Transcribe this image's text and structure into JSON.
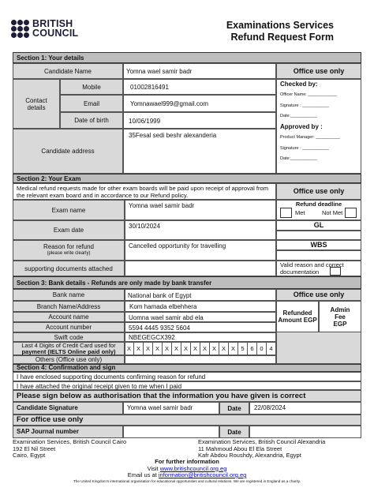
{
  "logo": {
    "line1": "BRITISH",
    "line2": "COUNCIL"
  },
  "header": {
    "line1": "Examinations Services",
    "line2": "Refund Request Form"
  },
  "section1": {
    "title": "Section 1: Your details",
    "candidate_name_label": "Candidate Name",
    "candidate_name_value": "Yomna wael samir badr",
    "contact_label_1": "Contact",
    "contact_label_2": "details",
    "mobile_label": "Mobile",
    "mobile_value": "01002816491",
    "email_label": "Email",
    "email_value": "Yomnawael999@gmail.com",
    "dob_label": "Date of birth",
    "dob_value": "10/06/1999",
    "address_label": "Candidate address",
    "address_value": "35Fesal sedi beshr alexanderia"
  },
  "office1": {
    "head": "Office use only",
    "checked_by": "Checked by:",
    "officer_name": "Officer Name: ____________",
    "signature": "Signature : ___________",
    "date": "Date:___________",
    "approved_by": "Approved by :",
    "product_manager": "Product Manager: __________",
    "signature2": "Signature : ___________",
    "date2": "Date:___________"
  },
  "section2": {
    "title": "Section 2: Your Exam",
    "notice": "Medical refund requests made for other exam boards will be paid upon receipt of approval from the relevant exam board and in accordance to our Refund policy.",
    "exam_name_label": "Exam name",
    "exam_name_value": "Yomna wael samir badr",
    "exam_date_label": "Exam date",
    "exam_date_value": "30/10/2024",
    "reason_label": "Reason for refund",
    "reason_sub": "(please write clearly)",
    "reason_value": "Cancelled opportunity for travelling",
    "docs_label": "supporting documents attached",
    "office_head": "Office use only",
    "refund_deadline": "Refund deadline",
    "met": "Met",
    "not_met": "Not Met",
    "gl": "GL",
    "wbs": "WBS",
    "valid_reason": "Valid reason and correct documentation"
  },
  "section3": {
    "title": "Section 3: Bank details - Refunds are only made by bank transfer",
    "bank_name_label": "Bank name",
    "bank_name_value": "National bank of Egypt",
    "branch_label": "Branch Name/Address",
    "branch_value": "Kom hamada elbehhera",
    "account_name_label": "Account name",
    "account_name_value": "Uomna wael samir abd ela",
    "account_number_label": "Account number",
    "account_number_value": "5594 4445 9352 5604",
    "swift_label": "Swift code",
    "swift_value": "NBEGEGCX392",
    "card_label_1": "Last 4 Digits of Credit Card used for",
    "card_label_2": "payment (IELTS Online paid only)",
    "card_digits": [
      "X",
      "X",
      "X",
      "X",
      "X",
      "X",
      "X",
      "X",
      "X",
      "X",
      "X",
      "X",
      "5",
      "6",
      "0",
      "4"
    ],
    "others_label": "Others (Office use only)",
    "office_head": "Office use only",
    "refunded_amount": "Refunded Amount EGP",
    "admin_fee": "Admin Fee EGP"
  },
  "section4": {
    "title": "Section 4: Confirmation and sign",
    "line1": "I have enclosed supporting documents confirming reason for refund",
    "line2": "I have attached the original receipt given to me when I paid",
    "authorise": "Please sign below as authorisation that the information you have given is correct",
    "sig_label": "Candidate Signature",
    "sig_value": "Yomna wael samir badr",
    "date_label": "Date",
    "date_value": "22/08/2024",
    "office_only": "For office use only",
    "sap_label": "SAP Journal  number",
    "sap_date_label": "Date"
  },
  "footer": {
    "left_1": "Examination Services, British Council Cairo",
    "left_2": "192 El Nil Street",
    "left_3": "Cairo, Egypt",
    "right_1": "Examination Services, British Council Alexandria",
    "right_2": "11 Mahmoud Abou El Ela Street",
    "right_3": "Kafr Abdou Roushdy, Alexandria, Egypt",
    "further": "For further information",
    "visit": "Visit",
    "visit_link": "www.britishcouncil.org.eg",
    "email_us": "Email us at",
    "email_link": "information@britishcouncil.org.eg",
    "tagline": "The United Kingdom's international organisation for educational opportunities and cultural relations. We are registered in England as a charity."
  }
}
